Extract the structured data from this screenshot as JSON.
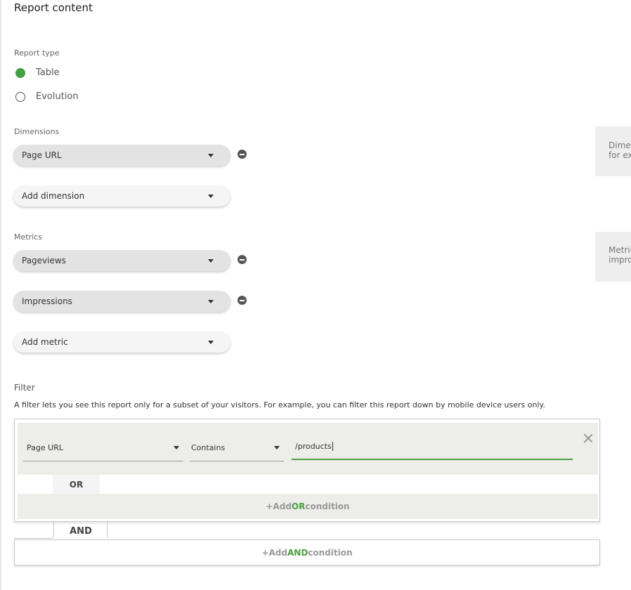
{
  "title": "Report content",
  "report_type": {
    "label": "Report type",
    "options": [
      "Table",
      "Evolution"
    ],
    "selected": "Table"
  },
  "dimensions": {
    "label": "Dimensions",
    "items": [
      "Page URL"
    ],
    "add_label": "Add dimension",
    "help_text": [
      "Dimer",
      "for ex"
    ]
  },
  "metrics": {
    "label": "Metrics",
    "items": [
      "Pageviews",
      "Impressions"
    ],
    "add_label": "Add metric",
    "help_text": [
      "Metric",
      "impro"
    ]
  },
  "filter": {
    "label": "Filter",
    "description": "A filter lets you see this report only for a subset of your visitors. For example, you can filter this report down by mobile device users only.",
    "condition": {
      "field": "Page URL",
      "operator": "Contains",
      "value": "/products"
    },
    "or_label": "OR",
    "add_or": {
      "prefix": "+Add ",
      "keyword": "OR",
      "suffix": " condition"
    },
    "and_label": "AND",
    "add_and": {
      "prefix": "+Add ",
      "keyword": "AND",
      "suffix": " condition"
    }
  },
  "colors": {
    "accent": "#43a047",
    "panel": "#ededea"
  }
}
